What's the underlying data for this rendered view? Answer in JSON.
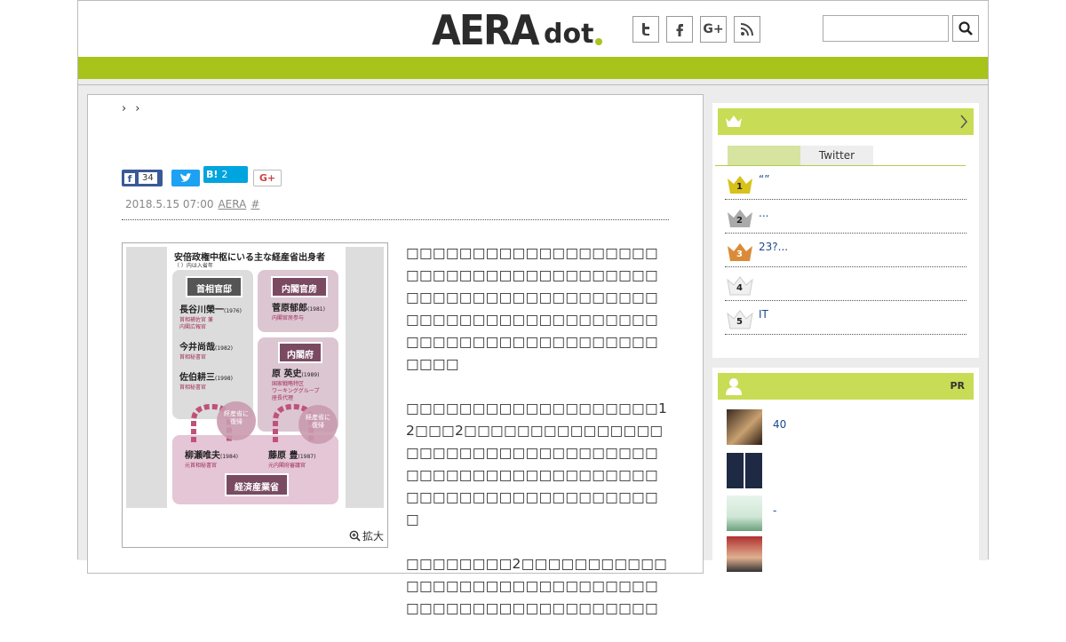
{
  "header": {
    "logo_main": "AERA",
    "logo_sub": "dot",
    "social": [
      {
        "icon": "twitter-icon",
        "glyph": "t"
      },
      {
        "icon": "facebook-icon",
        "glyph": "f"
      },
      {
        "icon": "google-plus-icon",
        "glyph": "G+"
      },
      {
        "icon": "rss-icon",
        "glyph": "rss"
      }
    ],
    "search_placeholder": ""
  },
  "colors": {
    "accent": "#a8c31a",
    "panel_head": "#c9dc55",
    "link": "#1a4a8f",
    "facebook": "#3b5998",
    "twitter": "#1da1f2",
    "hatena": "#00a4de"
  },
  "breadcrumb": [
    "›",
    "›"
  ],
  "share": {
    "facebook_count": "34",
    "hatena_label": "B!",
    "hatena_count": "2",
    "google_label": "G+"
  },
  "meta": {
    "date": "2018.5.15 07:00",
    "source": "AERA",
    "hash": "#"
  },
  "photo": {
    "title": "安倍政権中枢にいる主な経産省出身者",
    "note": "（ ）内は入省年",
    "box_kantei": "首相官邸",
    "box_kanbo": "内閣官房",
    "box_naikakufu": "内閣府",
    "people": [
      {
        "name": "長谷川榮一",
        "year": "(1976)",
        "role1": "首相補佐官 兼",
        "role2": "内閣広報官"
      },
      {
        "name": "今井尚哉",
        "year": "(1982)",
        "role1": "首相秘書官",
        "role2": ""
      },
      {
        "name": "佐伯耕三",
        "year": "(1998)",
        "role1": "首相秘書官",
        "role2": ""
      },
      {
        "name": "菅原郁郎",
        "year": "(1981)",
        "role1": "内閣官房参与",
        "role2": ""
      },
      {
        "name": "原 英史",
        "year": "(1989)",
        "role1": "国家戦略特区",
        "role2": "ワーキンググループ"
      },
      {
        "name": "柳瀬唯夫",
        "year": "(1984)",
        "role1": "元首相秘書官",
        "role2": ""
      },
      {
        "name": "藤原 豊",
        "year": "(1987)",
        "role1": "元内閣府審議官",
        "role2": ""
      }
    ],
    "role_extra": "座長代理",
    "return_label": "経産省に復帰",
    "ministry": "経済産業省",
    "zoom_label": "拡大"
  },
  "body": {
    "p1": "□□□□□□□□□□□□□□□□□□□□□□□□□□□□□□□□□□□□□□□□□□□□□□□□□□□□□□□□□□□□□□□□□□□□□□□□□□□□□□□□□□□□□□□□□□□□□□□□□□□",
    "p2": "□□□□□□□□□□□□□□□□□□□12□□□2□□□□□□□□□□□□□□□□□□□□□□□□□□□□□□□□□□□□□□□□□□□□□□□□□□□□□□□□□□□□□□□□□□□□□□□□□",
    "p3": "□□□□□□□□2□□□□□□□□□□□□□□□□□□□□□□□□□□□□□□□□□□□□□□□□□□□□□□□□□"
  },
  "ranking": {
    "tabs": [
      "",
      "Twitter"
    ],
    "items": [
      {
        "rank": "1",
        "text": "“”",
        "color": "#d8c21a"
      },
      {
        "rank": "2",
        "text": "...",
        "color": "#aaaaaa"
      },
      {
        "rank": "3",
        "text": "23?...",
        "color": "#d98b3a"
      },
      {
        "rank": "4",
        "text": "",
        "color": "#f0f0f0"
      },
      {
        "rank": "5",
        "text": "IT",
        "color": "#f0f0f0"
      }
    ]
  },
  "pr": {
    "label": "PR",
    "items": [
      {
        "text": "40"
      },
      {
        "text": ""
      },
      {
        "text": "-"
      },
      {
        "text": ""
      }
    ]
  }
}
